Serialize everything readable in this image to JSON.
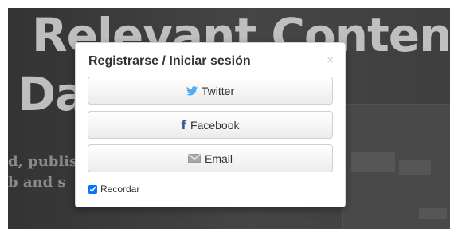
{
  "background": {
    "title_line1": "Relevant Content",
    "title_line2": "Da",
    "subtitle_line1": "d, publis",
    "subtitle_line2": "b and s"
  },
  "modal": {
    "title": "Registrarse / Iniciar sesión",
    "close_symbol": "×",
    "buttons": {
      "twitter": "Twitter",
      "facebook": "Facebook",
      "email": "Email"
    },
    "remember_label": "Recordar",
    "remember_checked": true
  },
  "colors": {
    "twitter_blue": "#55acee",
    "facebook_blue": "#3b5998",
    "email_gray": "#999999"
  },
  "icons": {
    "twitter": "twitter-bird-icon",
    "facebook": "facebook-f-icon",
    "email": "envelope-icon"
  }
}
